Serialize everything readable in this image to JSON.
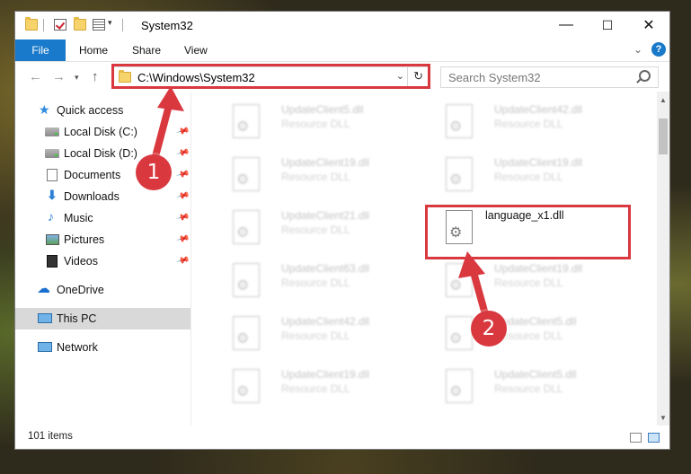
{
  "window": {
    "title": "System32",
    "controls": {
      "minimize": "—",
      "maximize": "☐",
      "close": "✕"
    }
  },
  "ribbon": {
    "tabs": [
      "File",
      "Home",
      "Share",
      "View"
    ],
    "help": "?"
  },
  "address": {
    "path": "C:\\Windows\\System32",
    "search_placeholder": "Search System32"
  },
  "sidebar": {
    "quick_access": "Quick access",
    "items": [
      {
        "label": "Local Disk (C:)",
        "icon": "drive-icon",
        "pinned": true
      },
      {
        "label": "Local Disk (D:)",
        "icon": "drive-icon",
        "pinned": true
      },
      {
        "label": "Documents",
        "icon": "documents-icon",
        "pinned": true
      },
      {
        "label": "Downloads",
        "icon": "download-icon",
        "pinned": true
      },
      {
        "label": "Music",
        "icon": "music-icon",
        "pinned": true
      },
      {
        "label": "Pictures",
        "icon": "pictures-icon",
        "pinned": true
      },
      {
        "label": "Videos",
        "icon": "videos-icon",
        "pinned": true
      }
    ],
    "onedrive": "OneDrive",
    "this_pc": "This PC",
    "network": "Network"
  },
  "files": {
    "left": [
      {
        "name": "UpdateClient5.dll",
        "type": "Resource DLL"
      },
      {
        "name": "UpdateClient19.dll",
        "type": "Resource DLL"
      },
      {
        "name": "UpdateClient21.dll",
        "type": "Resource DLL"
      },
      {
        "name": "UpdateClient63.dll",
        "type": "Resource DLL"
      },
      {
        "name": "UpdateClient42.dll",
        "type": "Resource DLL"
      },
      {
        "name": "UpdateClient19.dll",
        "type": "Resource DLL"
      }
    ],
    "right": [
      {
        "name": "UpdateClient42.dll",
        "type": "Resource DLL"
      },
      {
        "name": "UpdateClient19.dll",
        "type": "Resource DLL"
      },
      {
        "name": "language_x1.dll",
        "type": ""
      },
      {
        "name": "UpdateClient19.dll",
        "type": "Resource DLL"
      },
      {
        "name": "UpdateClient5.dll",
        "type": "Resource DLL"
      },
      {
        "name": "UpdateClient5.dll",
        "type": "Resource DLL"
      }
    ]
  },
  "status": {
    "count": "101 items"
  },
  "callouts": {
    "one": "1",
    "two": "2",
    "color": "#d9383f"
  }
}
